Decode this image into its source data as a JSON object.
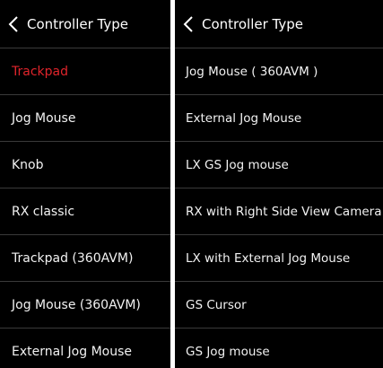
{
  "left_panel": {
    "back_icon": "chevron-left-icon",
    "title": "Controller Type",
    "selected_index": 0,
    "items": [
      {
        "label": "Trackpad"
      },
      {
        "label": "Jog Mouse"
      },
      {
        "label": "Knob"
      },
      {
        "label": "RX classic"
      },
      {
        "label": "Trackpad (360AVM)"
      },
      {
        "label": "Jog Mouse (360AVM)"
      },
      {
        "label": "External Jog Mouse"
      }
    ]
  },
  "right_panel": {
    "back_icon": "chevron-left-icon",
    "title": "Controller Type",
    "items": [
      {
        "label": "Jog Mouse ( 360AVM )"
      },
      {
        "label": "External Jog Mouse"
      },
      {
        "label": "LX GS Jog mouse"
      },
      {
        "label": "RX with Right Side View Camera"
      },
      {
        "label": "LX with External Jog Mouse"
      },
      {
        "label": "GS Cursor"
      },
      {
        "label": "GS Jog mouse"
      }
    ]
  },
  "colors": {
    "background": "#000000",
    "text": "#ffffff",
    "selected": "#e0242b",
    "separator": "#3a3a3a"
  }
}
